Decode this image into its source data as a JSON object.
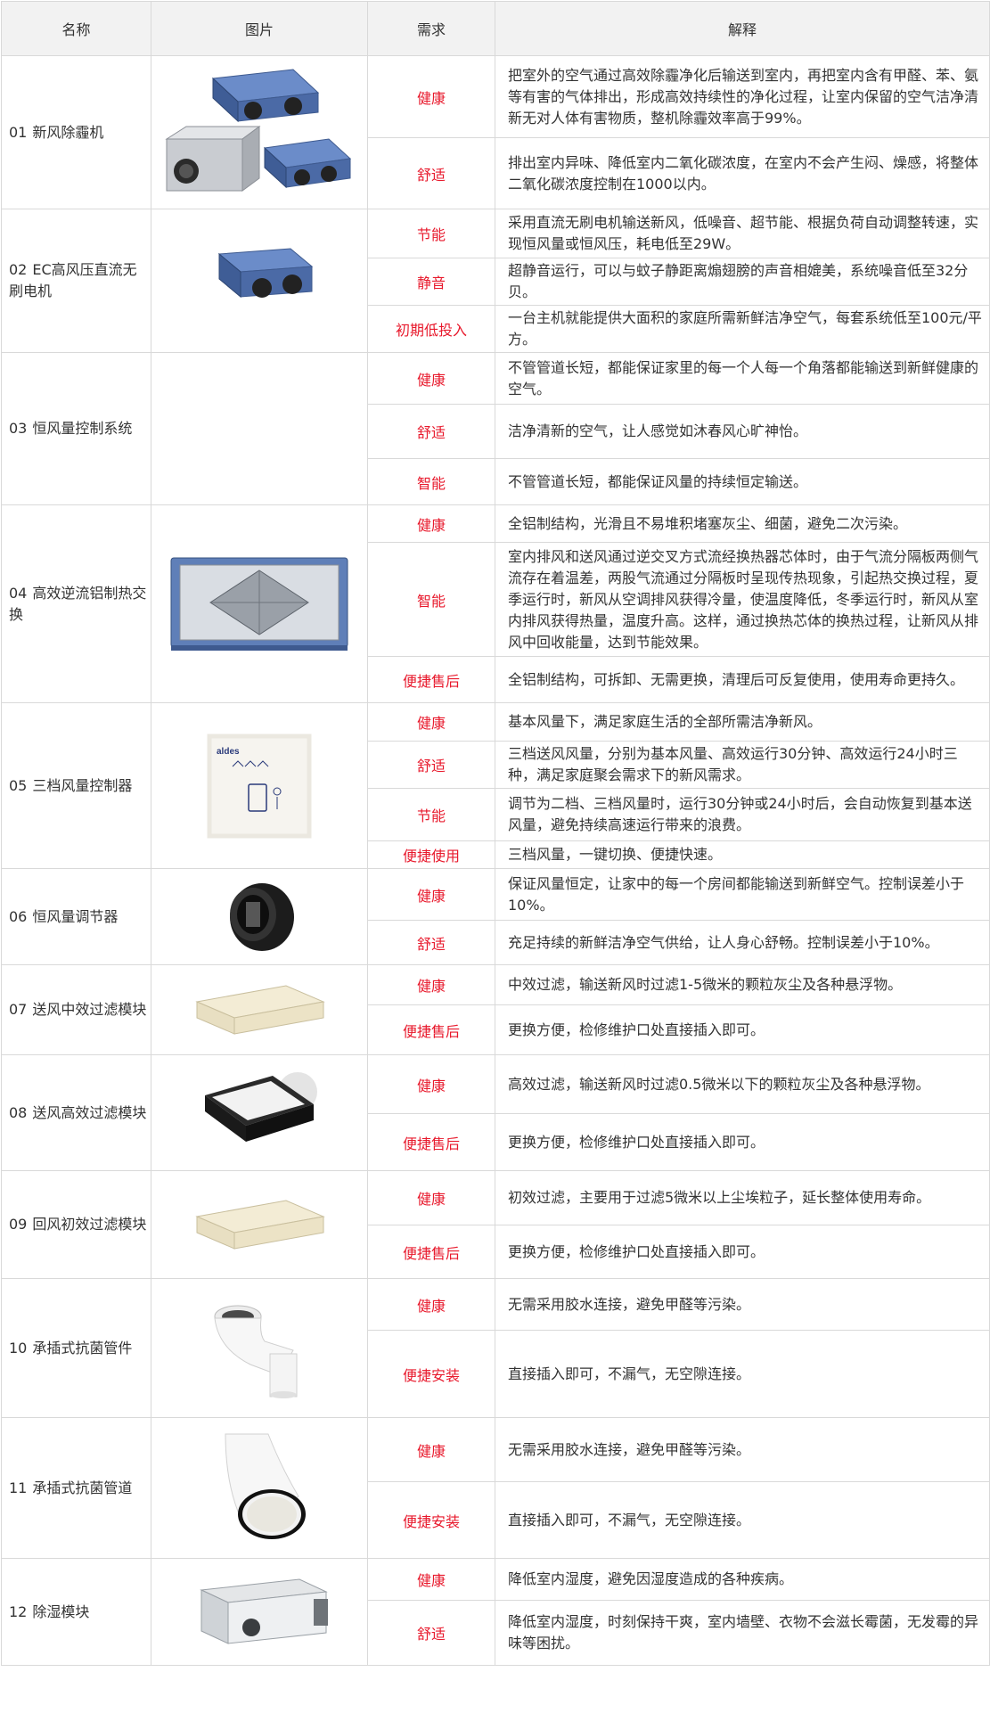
{
  "headers": {
    "name": "名称",
    "image": "图片",
    "requirement": "需求",
    "explanation": "解释"
  },
  "rows": [
    {
      "index": "01",
      "name": "新风除霾机",
      "icon": "fresh-air-purifier-icon",
      "features": [
        {
          "req": "健康",
          "text": "把室外的空气通过高效除霾净化后输送到室内，再把室内含有甲醛、苯、氨等有害的气体排出，形成高效持续性的净化过程，让室内保留的空气洁净清新无对人体有害物质，整机除霾效率高于99%。"
        },
        {
          "req": "舒适",
          "text": "排出室内异味、降低室内二氧化碳浓度，在室内不会产生闷、燥感，将整体二氧化碳浓度控制在1000以内。"
        }
      ]
    },
    {
      "index": "02",
      "name": "EC高风压直流无刷电机",
      "icon": "ec-motor-unit-icon",
      "features": [
        {
          "req": "节能",
          "text": "采用直流无刷电机输送新风，低噪音、超节能、根据负荷自动调整转速，实现恒风量或恒风压，耗电低至29W。"
        },
        {
          "req": "静音",
          "text": "超静音运行，可以与蚊子静距离煽翅膀的声音相媲美，系统噪音低至32分贝。"
        },
        {
          "req": "初期低投入",
          "text": "一台主机就能提供大面积的家庭所需新鲜洁净空气，每套系统低至100元/平方。"
        }
      ]
    },
    {
      "index": "03",
      "name": "恒风量控制系统",
      "icon": "",
      "features": [
        {
          "req": "健康",
          "text": "不管管道长短，都能保证家里的每一个人每一个角落都能输送到新鲜健康的空气。"
        },
        {
          "req": "舒适",
          "text": "洁净清新的空气，让人感觉如沐春风心旷神怡。"
        },
        {
          "req": "智能",
          "text": "不管管道长短，都能保证风量的持续恒定输送。"
        }
      ]
    },
    {
      "index": "04",
      "name": "高效逆流铝制热交换",
      "icon": "heat-exchanger-icon",
      "features": [
        {
          "req": "健康",
          "text": "全铝制结构，光滑且不易堆积堵塞灰尘、细菌，避免二次污染。"
        },
        {
          "req": "智能",
          "text": "室内排风和送风通过逆交叉方式流经换热器芯体时，由于气流分隔板两侧气流存在着温差，两股气流通过分隔板时呈现传热现象，引起热交换过程，夏季运行时，新风从空调排风获得冷量，使温度降低，冬季运行时，新风从室内排风获得热量，温度升高。这样，通过换热芯体的换热过程，让新风从排风中回收能量，达到节能效果。"
        },
        {
          "req": "便捷售后",
          "text": "全铝制结构，可拆卸、无需更换，清理后可反复使用，使用寿命更持久。"
        }
      ]
    },
    {
      "index": "05",
      "name": "三档风量控制器",
      "icon": "controller-panel-icon",
      "brand": "aldes",
      "features": [
        {
          "req": "健康",
          "text": "基本风量下，满足家庭生活的全部所需洁净新风。"
        },
        {
          "req": "舒适",
          "text": "三档送风风量，分别为基本风量、高效运行30分钟、高效运行24小时三种，满足家庭聚会需求下的新风需求。"
        },
        {
          "req": "节能",
          "text": "调节为二档、三档风量时，运行30分钟或24小时后，会自动恢复到基本送风量，避免持续高速运行带来的浪费。"
        },
        {
          "req": "便捷使用",
          "text": "三档风量，一键切换、便捷快速。"
        }
      ]
    },
    {
      "index": "06",
      "name": "恒风量调节器",
      "icon": "flow-regulator-icon",
      "features": [
        {
          "req": "健康",
          "text": "保证风量恒定，让家中的每一个房间都能输送到新鲜空气。控制误差小于10%。"
        },
        {
          "req": "舒适",
          "text": "充足持续的新鲜洁净空气供给，让人身心舒畅。控制误差小于10%。"
        }
      ]
    },
    {
      "index": "07",
      "name": "送风中效过滤模块",
      "icon": "medium-filter-icon",
      "features": [
        {
          "req": "健康",
          "text": "中效过滤，输送新风时过滤1-5微米的颗粒灰尘及各种悬浮物。"
        },
        {
          "req": "便捷售后",
          "text": "更换方便，检修维护口处直接插入即可。"
        }
      ]
    },
    {
      "index": "08",
      "name": "送风高效过滤模块",
      "icon": "hepa-filter-icon",
      "features": [
        {
          "req": "健康",
          "text": "高效过滤，输送新风时过滤0.5微米以下的颗粒灰尘及各种悬浮物。"
        },
        {
          "req": "便捷售后",
          "text": "更换方便，检修维护口处直接插入即可。"
        }
      ]
    },
    {
      "index": "09",
      "name": "回风初效过滤模块",
      "icon": "primary-filter-icon",
      "features": [
        {
          "req": "健康",
          "text": "初效过滤，主要用于过滤5微米以上尘埃粒子，延长整体使用寿命。"
        },
        {
          "req": "便捷售后",
          "text": "更换方便，检修维护口处直接插入即可。"
        }
      ]
    },
    {
      "index": "10",
      "name": "承插式抗菌管件",
      "icon": "pipe-elbow-icon",
      "features": [
        {
          "req": "健康",
          "text": "无需采用胶水连接，避免甲醛等污染。"
        },
        {
          "req": "便捷安装",
          "text": "直接插入即可，不漏气，无空隙连接。"
        }
      ]
    },
    {
      "index": "11",
      "name": "承插式抗菌管道",
      "icon": "pipe-section-icon",
      "features": [
        {
          "req": "健康",
          "text": "无需采用胶水连接，避免甲醛等污染。"
        },
        {
          "req": "便捷安装",
          "text": "直接插入即可，不漏气，无空隙连接。"
        }
      ]
    },
    {
      "index": "12",
      "name": "除湿模块",
      "icon": "dehumidifier-icon",
      "features": [
        {
          "req": "健康",
          "text": "降低室内湿度，避免因湿度造成的各种疾病。"
        },
        {
          "req": "舒适",
          "text": "降低室内湿度，时刻保持干爽，室内墙壁、衣物不会滋长霉菌，无发霉的异味等困扰。"
        }
      ]
    }
  ]
}
